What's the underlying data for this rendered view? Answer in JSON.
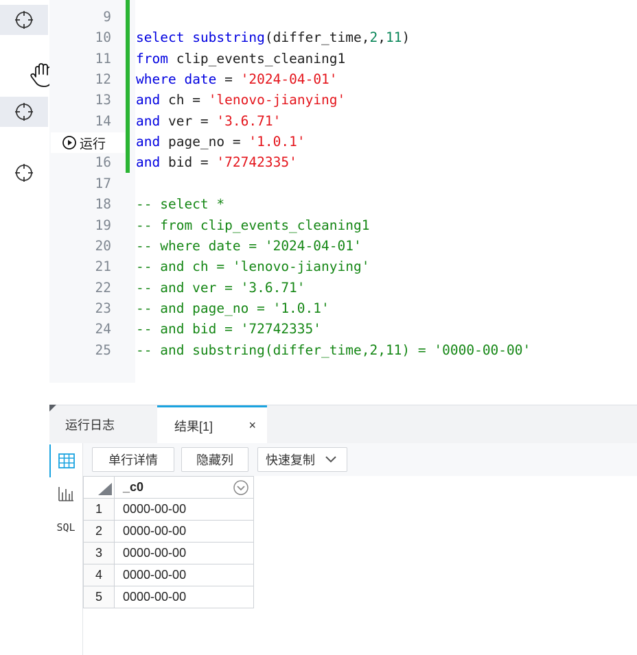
{
  "editor": {
    "lines": [
      {
        "n": "9",
        "tokens": []
      },
      {
        "n": "10",
        "tokens": [
          {
            "t": "select",
            "c": "kw"
          },
          {
            "t": " "
          },
          {
            "t": "substring",
            "c": "kw"
          },
          {
            "t": "(differ_time,"
          },
          {
            "t": "2",
            "c": "num"
          },
          {
            "t": ","
          },
          {
            "t": "11",
            "c": "num"
          },
          {
            "t": ")"
          }
        ]
      },
      {
        "n": "11",
        "tokens": [
          {
            "t": "from",
            "c": "kw"
          },
          {
            "t": " clip_events_cleaning1"
          }
        ]
      },
      {
        "n": "12",
        "tokens": [
          {
            "t": "where",
            "c": "kw"
          },
          {
            "t": " "
          },
          {
            "t": "date",
            "c": "kw"
          },
          {
            "t": " = "
          },
          {
            "t": "'2024-04-01'",
            "c": "str"
          }
        ]
      },
      {
        "n": "13",
        "tokens": [
          {
            "t": "and",
            "c": "kw"
          },
          {
            "t": " ch = "
          },
          {
            "t": "'lenovo-jianying'",
            "c": "str"
          }
        ]
      },
      {
        "n": "14",
        "tokens": [
          {
            "t": "and",
            "c": "kw"
          },
          {
            "t": " ver = "
          },
          {
            "t": "'3.6.71'",
            "c": "str"
          }
        ]
      },
      {
        "n": "15",
        "tokens": [
          {
            "t": "and",
            "c": "kw"
          },
          {
            "t": " page_no = "
          },
          {
            "t": "'1.0.1'",
            "c": "str"
          }
        ]
      },
      {
        "n": "16",
        "tokens": [
          {
            "t": "and",
            "c": "kw"
          },
          {
            "t": " bid = "
          },
          {
            "t": "'72742335'",
            "c": "str"
          }
        ]
      },
      {
        "n": "17",
        "tokens": []
      },
      {
        "n": "18",
        "tokens": [
          {
            "t": "-- select *",
            "c": "cm"
          }
        ]
      },
      {
        "n": "19",
        "tokens": [
          {
            "t": "-- from clip_events_cleaning1",
            "c": "cm"
          }
        ]
      },
      {
        "n": "20",
        "tokens": [
          {
            "t": "-- where date = '2024-04-01'",
            "c": "cm"
          }
        ]
      },
      {
        "n": "21",
        "tokens": [
          {
            "t": "-- and ch = 'lenovo-jianying'",
            "c": "cm"
          }
        ]
      },
      {
        "n": "22",
        "tokens": [
          {
            "t": "-- and ver = '3.6.71'",
            "c": "cm"
          }
        ]
      },
      {
        "n": "23",
        "tokens": [
          {
            "t": "-- and page_no = '1.0.1'",
            "c": "cm"
          }
        ]
      },
      {
        "n": "24",
        "tokens": [
          {
            "t": "-- and bid = '72742335'",
            "c": "cm"
          }
        ]
      },
      {
        "n": "25",
        "tokens": [
          {
            "t": "-- and substring(differ_time,2,11) = '0000-00-00'",
            "c": "cm"
          }
        ]
      }
    ],
    "run_label": "运行"
  },
  "tabs": {
    "log_label": "运行日志",
    "result_label": "结果[1]",
    "close_glyph": "×"
  },
  "side": {
    "sql_label": "SQL"
  },
  "toolbar": {
    "row_detail_label": "单行详情",
    "hide_column_label": "隐藏列",
    "quick_copy_label": "快速复制"
  },
  "result": {
    "column": "_c0",
    "rows": [
      {
        "n": "1",
        "v": "0000-00-00"
      },
      {
        "n": "2",
        "v": "0000-00-00"
      },
      {
        "n": "3",
        "v": "0000-00-00"
      },
      {
        "n": "4",
        "v": "0000-00-00"
      },
      {
        "n": "5",
        "v": "0000-00-00"
      }
    ]
  },
  "colors": {
    "accent": "#1aa3e0",
    "modified_bar": "#2bb534",
    "keyword": "#0000e0",
    "string": "#e4141b",
    "comment": "#158715"
  }
}
